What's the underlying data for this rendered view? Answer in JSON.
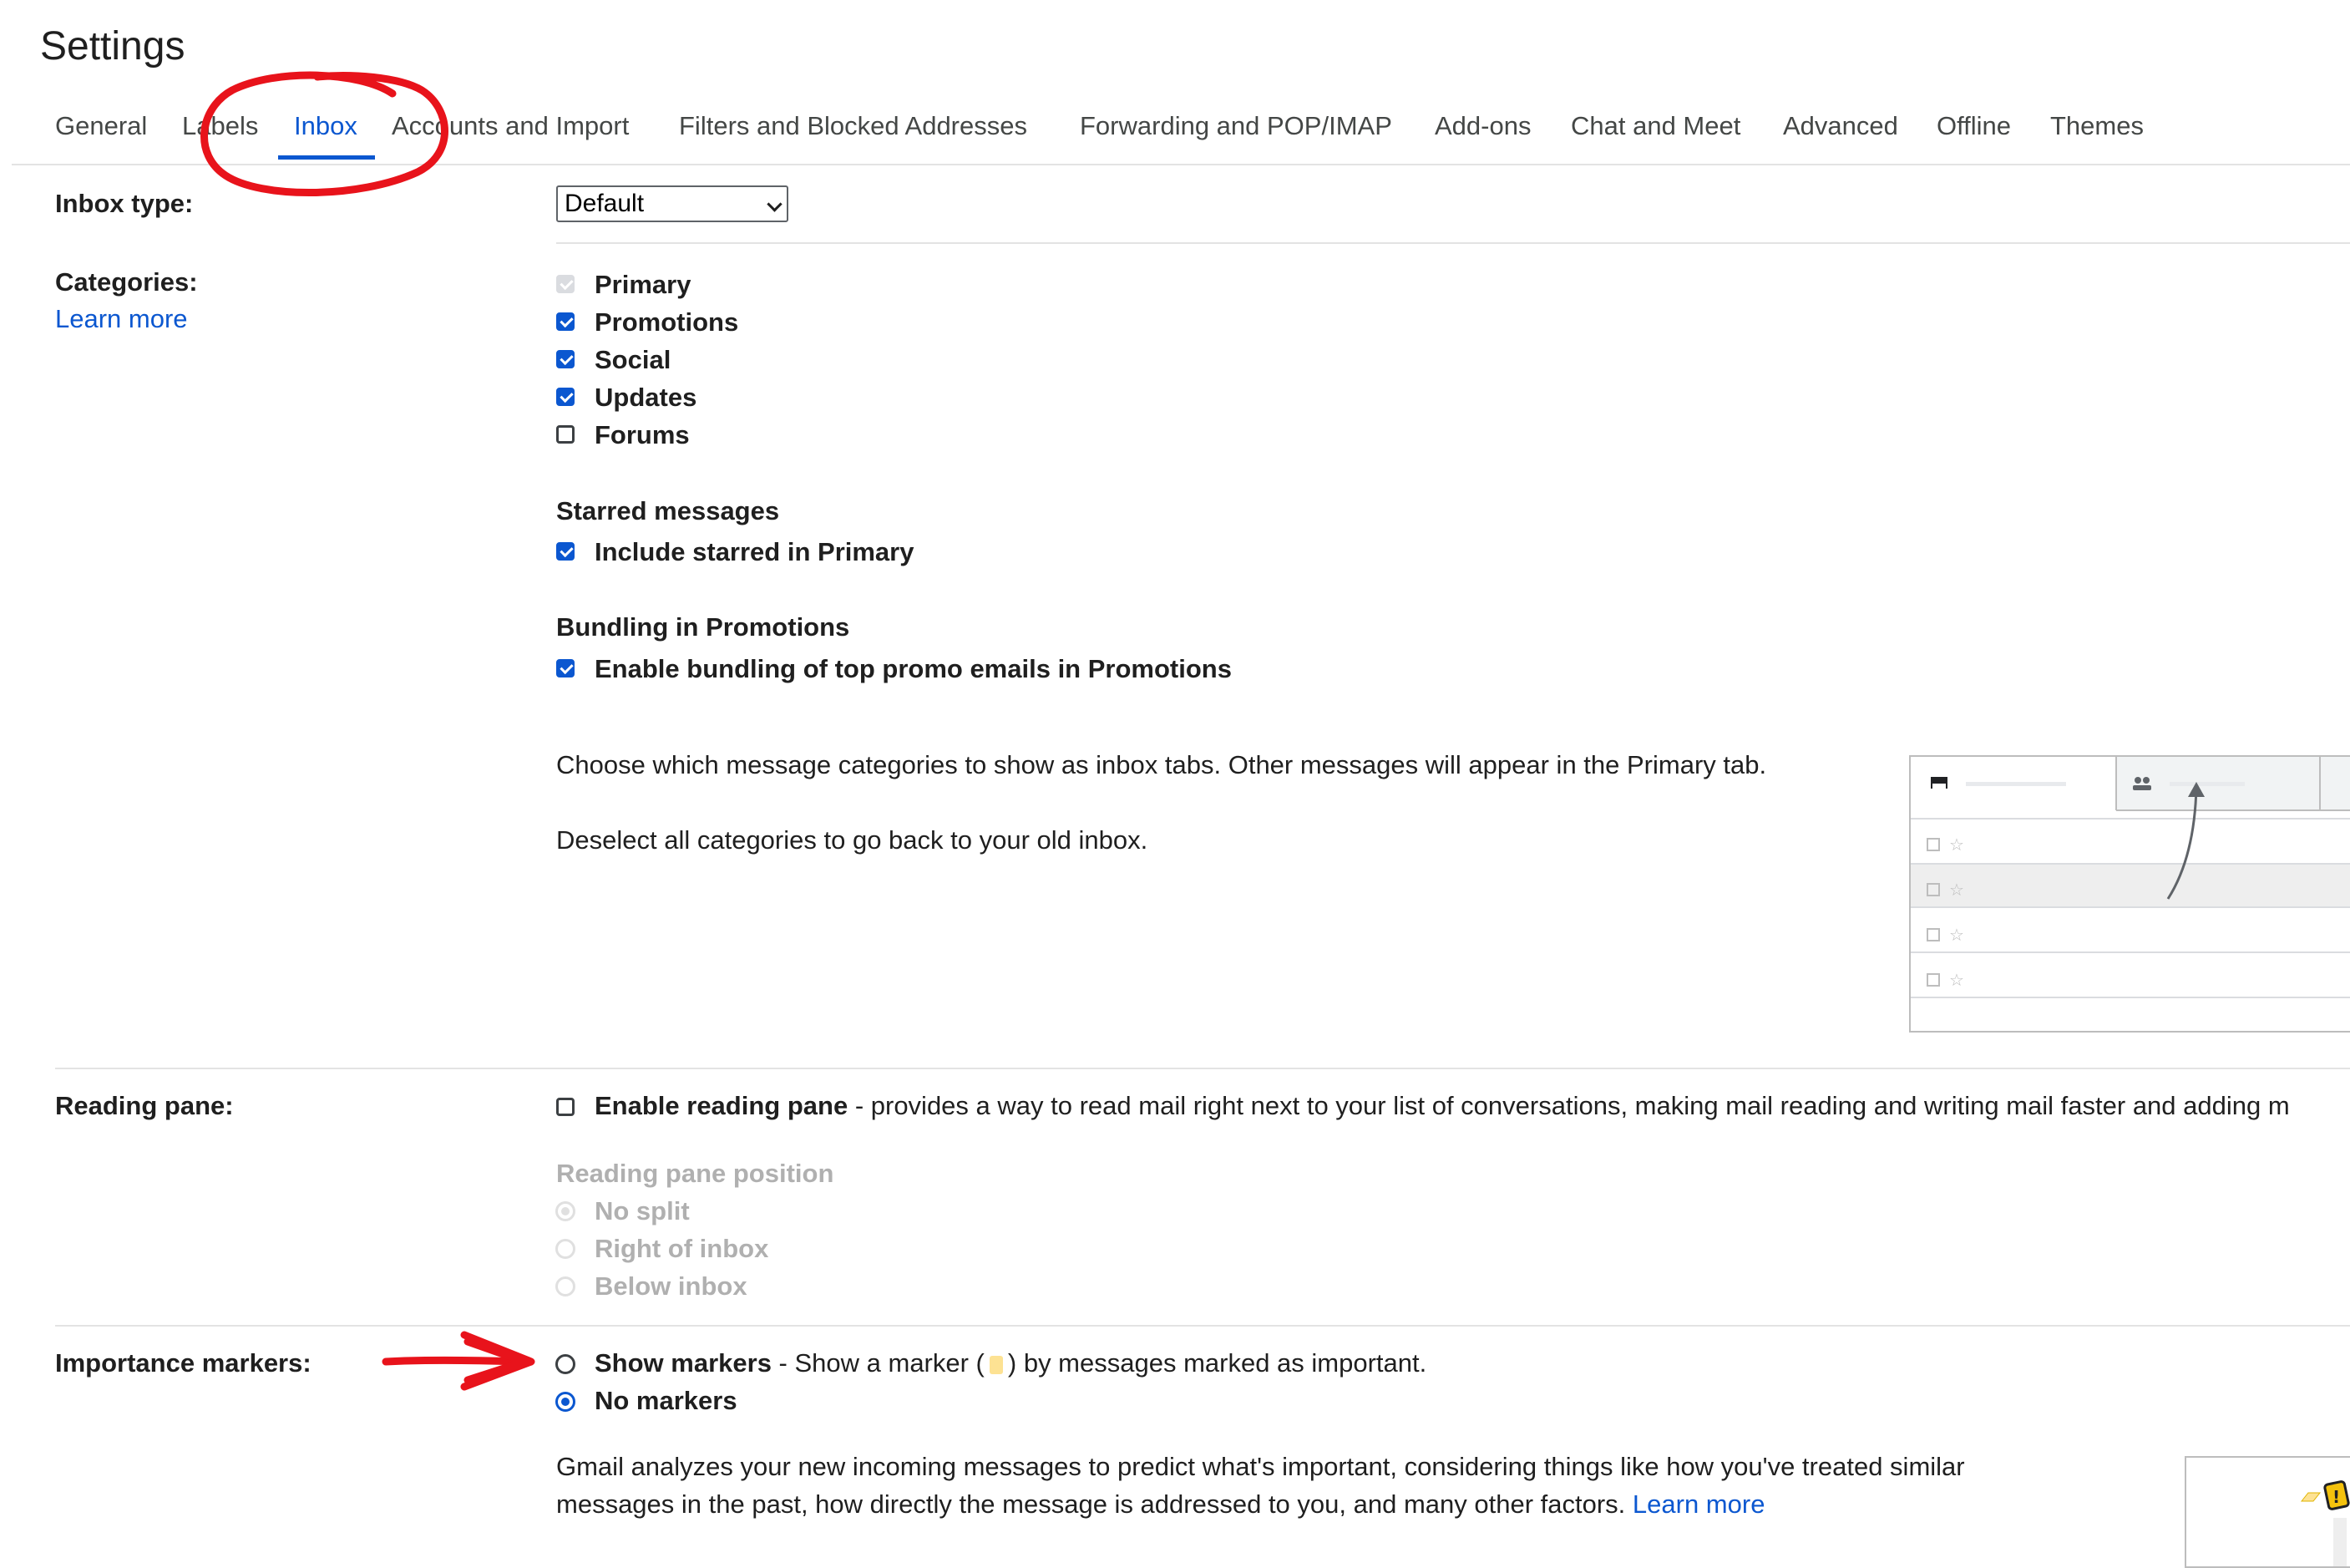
{
  "header": {
    "title": "Settings"
  },
  "tabs": [
    {
      "label": "General"
    },
    {
      "label": "Labels"
    },
    {
      "label": "Inbox"
    },
    {
      "label": "Accounts and Import"
    },
    {
      "label": "Filters and Blocked Addresses"
    },
    {
      "label": "Forwarding and POP/IMAP"
    },
    {
      "label": "Add-ons"
    },
    {
      "label": "Chat and Meet"
    },
    {
      "label": "Advanced"
    },
    {
      "label": "Offline"
    },
    {
      "label": "Themes"
    }
  ],
  "active_tab": "Inbox",
  "inbox_type": {
    "label": "Inbox type:",
    "value": "Default"
  },
  "categories": {
    "label": "Categories:",
    "learn_more": "Learn more",
    "items": [
      {
        "label": "Primary",
        "checked": true,
        "disabled": true
      },
      {
        "label": "Promotions",
        "checked": true
      },
      {
        "label": "Social",
        "checked": true
      },
      {
        "label": "Updates",
        "checked": true
      },
      {
        "label": "Forums",
        "checked": false
      }
    ],
    "starred": {
      "heading": "Starred messages",
      "option": "Include starred in Primary",
      "checked": true
    },
    "bundling": {
      "heading": "Bundling in Promotions",
      "option": "Enable bundling of top promo emails in Promotions",
      "checked": true
    },
    "description1": "Choose which message categories to show as inbox tabs. Other messages will appear in the Primary tab.",
    "description2": "Deselect all categories to go back to your old inbox."
  },
  "reading_pane": {
    "label": "Reading pane:",
    "enable_label": "Enable reading pane",
    "enable_desc": " - provides a way to read mail right next to your list of conversations, making mail reading and writing mail faster and adding m",
    "position_heading": "Reading pane position",
    "positions": [
      "No split",
      "Right of inbox",
      "Below inbox"
    ]
  },
  "importance": {
    "label": "Importance markers:",
    "show_label": "Show markers",
    "show_desc_pre": " - Show a marker (",
    "show_desc_post": ") by messages marked as important.",
    "no_label": "No markers",
    "selected": "No markers",
    "desc_line1": "Gmail analyzes your new incoming messages to predict what's important, considering things like how you've treated similar",
    "desc_line2": "messages in the past, how directly the message is addressed to you, and many other factors.",
    "learn_more": "Learn more"
  },
  "colors": {
    "accent": "#0b57d0",
    "annotation": "#e8131b",
    "marker": "#fde293"
  }
}
